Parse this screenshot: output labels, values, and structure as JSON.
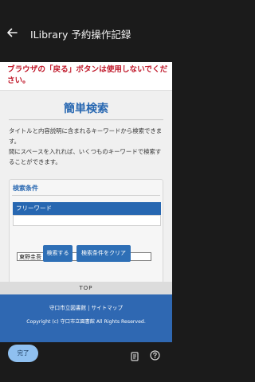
{
  "appbar": {
    "title": "ILibrary 予約操作記録"
  },
  "warning": {
    "text": "ブラウザの「戻る」ボタンは使用しないでください。"
  },
  "search_page": {
    "title": "簡単検索",
    "description_1": "タイトルと内容説明に含まれるキーワードから検索できます。",
    "description_2": "間にスペースを入れれば、いくつものキーワードで検索することができます。",
    "conditions_title": "検索条件",
    "field_label": "フリーワード",
    "keyword_value": "東野圭吾",
    "search_label": "検索する",
    "clear_label": "検索条件をクリア"
  },
  "top_link": "TOP",
  "footer": {
    "links": "守口市立図書館 | サイトマップ",
    "copyright": "Copyright (c) 守口市立図書館 All Rights Reserved."
  },
  "bottombar": {
    "done_label": "完了"
  },
  "icons": {
    "back": "arrow-left",
    "document": "document",
    "help": "question-circle"
  },
  "colors": {
    "accent_blue": "#2767b1",
    "warning_red": "#c0182a",
    "done_button": "#8fc0f0"
  }
}
